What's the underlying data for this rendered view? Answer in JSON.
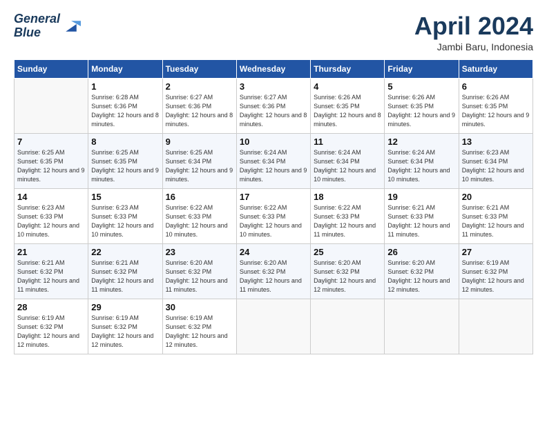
{
  "logo": {
    "line1": "General",
    "line2": "Blue"
  },
  "title": "April 2024",
  "location": "Jambi Baru, Indonesia",
  "days_header": [
    "Sunday",
    "Monday",
    "Tuesday",
    "Wednesday",
    "Thursday",
    "Friday",
    "Saturday"
  ],
  "weeks": [
    [
      {
        "day": "",
        "sunrise": "",
        "sunset": "",
        "daylight": ""
      },
      {
        "day": "1",
        "sunrise": "Sunrise: 6:28 AM",
        "sunset": "Sunset: 6:36 PM",
        "daylight": "Daylight: 12 hours and 8 minutes."
      },
      {
        "day": "2",
        "sunrise": "Sunrise: 6:27 AM",
        "sunset": "Sunset: 6:36 PM",
        "daylight": "Daylight: 12 hours and 8 minutes."
      },
      {
        "day": "3",
        "sunrise": "Sunrise: 6:27 AM",
        "sunset": "Sunset: 6:36 PM",
        "daylight": "Daylight: 12 hours and 8 minutes."
      },
      {
        "day": "4",
        "sunrise": "Sunrise: 6:26 AM",
        "sunset": "Sunset: 6:35 PM",
        "daylight": "Daylight: 12 hours and 8 minutes."
      },
      {
        "day": "5",
        "sunrise": "Sunrise: 6:26 AM",
        "sunset": "Sunset: 6:35 PM",
        "daylight": "Daylight: 12 hours and 9 minutes."
      },
      {
        "day": "6",
        "sunrise": "Sunrise: 6:26 AM",
        "sunset": "Sunset: 6:35 PM",
        "daylight": "Daylight: 12 hours and 9 minutes."
      }
    ],
    [
      {
        "day": "7",
        "sunrise": "Sunrise: 6:25 AM",
        "sunset": "Sunset: 6:35 PM",
        "daylight": "Daylight: 12 hours and 9 minutes."
      },
      {
        "day": "8",
        "sunrise": "Sunrise: 6:25 AM",
        "sunset": "Sunset: 6:35 PM",
        "daylight": "Daylight: 12 hours and 9 minutes."
      },
      {
        "day": "9",
        "sunrise": "Sunrise: 6:25 AM",
        "sunset": "Sunset: 6:34 PM",
        "daylight": "Daylight: 12 hours and 9 minutes."
      },
      {
        "day": "10",
        "sunrise": "Sunrise: 6:24 AM",
        "sunset": "Sunset: 6:34 PM",
        "daylight": "Daylight: 12 hours and 9 minutes."
      },
      {
        "day": "11",
        "sunrise": "Sunrise: 6:24 AM",
        "sunset": "Sunset: 6:34 PM",
        "daylight": "Daylight: 12 hours and 10 minutes."
      },
      {
        "day": "12",
        "sunrise": "Sunrise: 6:24 AM",
        "sunset": "Sunset: 6:34 PM",
        "daylight": "Daylight: 12 hours and 10 minutes."
      },
      {
        "day": "13",
        "sunrise": "Sunrise: 6:23 AM",
        "sunset": "Sunset: 6:34 PM",
        "daylight": "Daylight: 12 hours and 10 minutes."
      }
    ],
    [
      {
        "day": "14",
        "sunrise": "Sunrise: 6:23 AM",
        "sunset": "Sunset: 6:33 PM",
        "daylight": "Daylight: 12 hours and 10 minutes."
      },
      {
        "day": "15",
        "sunrise": "Sunrise: 6:23 AM",
        "sunset": "Sunset: 6:33 PM",
        "daylight": "Daylight: 12 hours and 10 minutes."
      },
      {
        "day": "16",
        "sunrise": "Sunrise: 6:22 AM",
        "sunset": "Sunset: 6:33 PM",
        "daylight": "Daylight: 12 hours and 10 minutes."
      },
      {
        "day": "17",
        "sunrise": "Sunrise: 6:22 AM",
        "sunset": "Sunset: 6:33 PM",
        "daylight": "Daylight: 12 hours and 10 minutes."
      },
      {
        "day": "18",
        "sunrise": "Sunrise: 6:22 AM",
        "sunset": "Sunset: 6:33 PM",
        "daylight": "Daylight: 12 hours and 11 minutes."
      },
      {
        "day": "19",
        "sunrise": "Sunrise: 6:21 AM",
        "sunset": "Sunset: 6:33 PM",
        "daylight": "Daylight: 12 hours and 11 minutes."
      },
      {
        "day": "20",
        "sunrise": "Sunrise: 6:21 AM",
        "sunset": "Sunset: 6:33 PM",
        "daylight": "Daylight: 12 hours and 11 minutes."
      }
    ],
    [
      {
        "day": "21",
        "sunrise": "Sunrise: 6:21 AM",
        "sunset": "Sunset: 6:32 PM",
        "daylight": "Daylight: 12 hours and 11 minutes."
      },
      {
        "day": "22",
        "sunrise": "Sunrise: 6:21 AM",
        "sunset": "Sunset: 6:32 PM",
        "daylight": "Daylight: 12 hours and 11 minutes."
      },
      {
        "day": "23",
        "sunrise": "Sunrise: 6:20 AM",
        "sunset": "Sunset: 6:32 PM",
        "daylight": "Daylight: 12 hours and 11 minutes."
      },
      {
        "day": "24",
        "sunrise": "Sunrise: 6:20 AM",
        "sunset": "Sunset: 6:32 PM",
        "daylight": "Daylight: 12 hours and 11 minutes."
      },
      {
        "day": "25",
        "sunrise": "Sunrise: 6:20 AM",
        "sunset": "Sunset: 6:32 PM",
        "daylight": "Daylight: 12 hours and 12 minutes."
      },
      {
        "day": "26",
        "sunrise": "Sunrise: 6:20 AM",
        "sunset": "Sunset: 6:32 PM",
        "daylight": "Daylight: 12 hours and 12 minutes."
      },
      {
        "day": "27",
        "sunrise": "Sunrise: 6:19 AM",
        "sunset": "Sunset: 6:32 PM",
        "daylight": "Daylight: 12 hours and 12 minutes."
      }
    ],
    [
      {
        "day": "28",
        "sunrise": "Sunrise: 6:19 AM",
        "sunset": "Sunset: 6:32 PM",
        "daylight": "Daylight: 12 hours and 12 minutes."
      },
      {
        "day": "29",
        "sunrise": "Sunrise: 6:19 AM",
        "sunset": "Sunset: 6:32 PM",
        "daylight": "Daylight: 12 hours and 12 minutes."
      },
      {
        "day": "30",
        "sunrise": "Sunrise: 6:19 AM",
        "sunset": "Sunset: 6:32 PM",
        "daylight": "Daylight: 12 hours and 12 minutes."
      },
      {
        "day": "",
        "sunrise": "",
        "sunset": "",
        "daylight": ""
      },
      {
        "day": "",
        "sunrise": "",
        "sunset": "",
        "daylight": ""
      },
      {
        "day": "",
        "sunrise": "",
        "sunset": "",
        "daylight": ""
      },
      {
        "day": "",
        "sunrise": "",
        "sunset": "",
        "daylight": ""
      }
    ]
  ]
}
